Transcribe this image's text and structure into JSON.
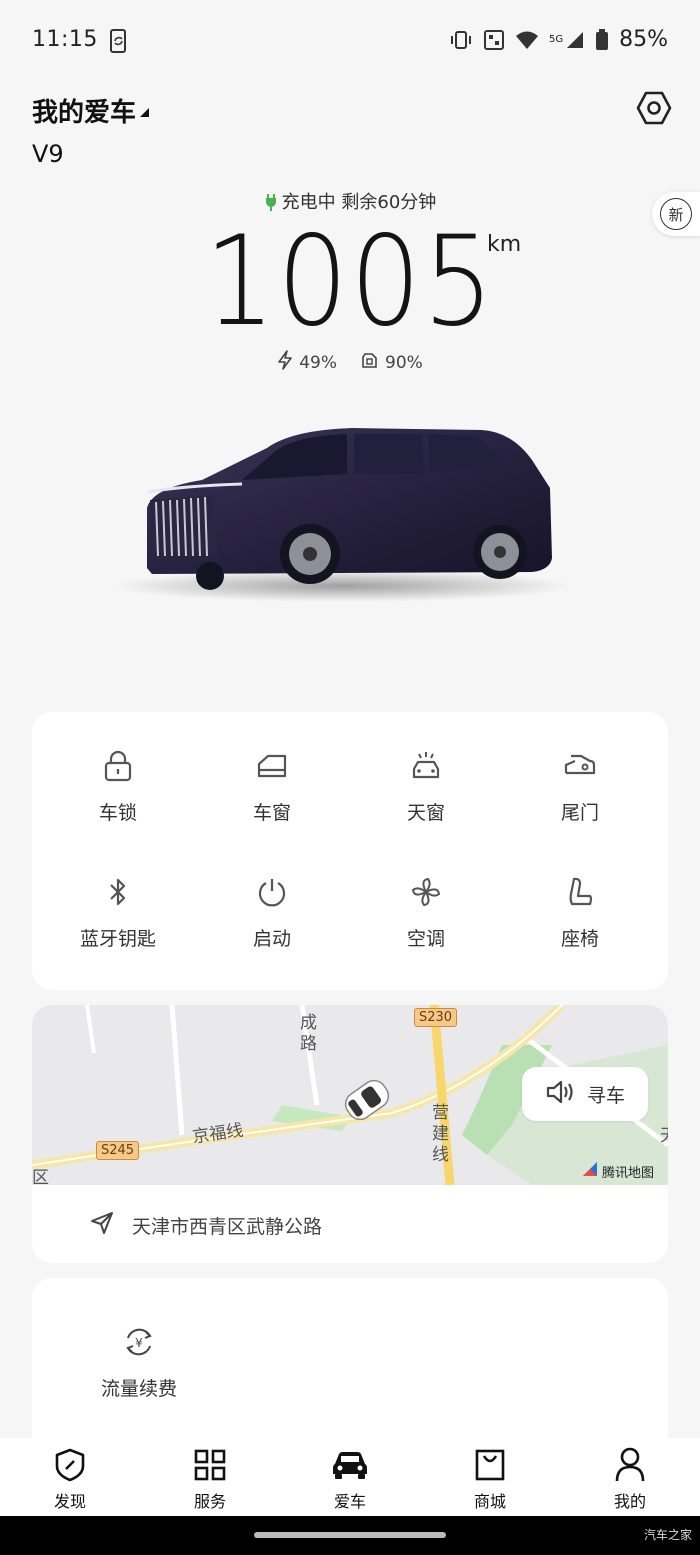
{
  "status_bar": {
    "time": "11:15",
    "network": "5G",
    "battery": "85%"
  },
  "header": {
    "title": "我的爱车",
    "model": "V9",
    "badge": "新"
  },
  "charging": {
    "status": "充电中 剩余60分钟",
    "range_value": "1005",
    "range_unit": "km",
    "battery_pct": "49%",
    "fuel_pct": "90%"
  },
  "controls": [
    {
      "label": "车锁",
      "icon": "lock-icon"
    },
    {
      "label": "车窗",
      "icon": "window-icon"
    },
    {
      "label": "天窗",
      "icon": "sunroof-icon"
    },
    {
      "label": "尾门",
      "icon": "tailgate-icon"
    },
    {
      "label": "蓝牙钥匙",
      "icon": "bluetooth-icon"
    },
    {
      "label": "启动",
      "icon": "power-icon"
    },
    {
      "label": "空调",
      "icon": "fan-icon"
    },
    {
      "label": "座椅",
      "icon": "seat-icon"
    }
  ],
  "map": {
    "road_labels": [
      "成路",
      "京福线",
      "营建线"
    ],
    "road_signs": [
      "S230",
      "S245"
    ],
    "edge_labels": [
      "区",
      "天"
    ],
    "find_car_label": "寻车",
    "provider": "腾讯地图",
    "address": "天津市西青区武静公路"
  },
  "services": [
    {
      "label": "流量续费",
      "icon": "renew-icon"
    }
  ],
  "bottom_nav": [
    {
      "label": "发现",
      "icon": "compass-icon"
    },
    {
      "label": "服务",
      "icon": "grid-icon"
    },
    {
      "label": "爱车",
      "icon": "car-icon",
      "active": true
    },
    {
      "label": "商城",
      "icon": "bag-icon"
    },
    {
      "label": "我的",
      "icon": "person-icon"
    }
  ],
  "watermark": "汽车之家",
  "colors": {
    "charging_green": "#4caf50",
    "map_road_yellow": "#f7d66b",
    "map_green": "#b9e0b2"
  }
}
